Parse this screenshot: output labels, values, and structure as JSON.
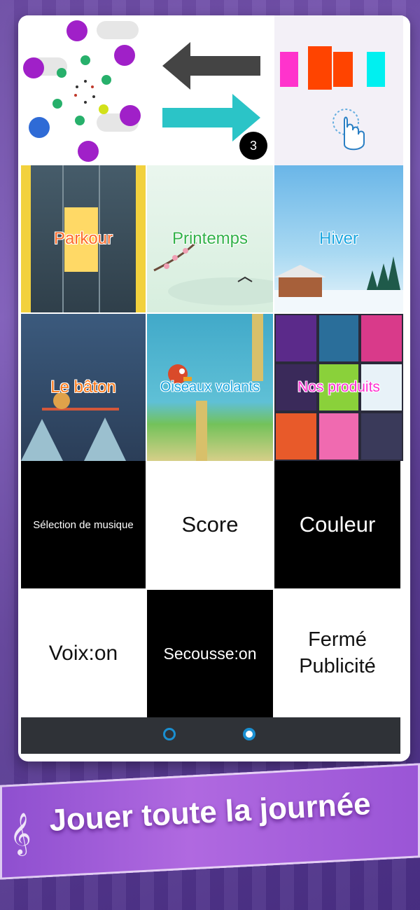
{
  "top": {
    "badge": "3",
    "colors": {
      "pink": "#ff33cc",
      "red": "#ff4400",
      "cyan": "#00f0f0",
      "dark_arrow": "#444444",
      "teal_arrow": "#2bc4c7"
    }
  },
  "games": [
    {
      "label": "Parkour",
      "color": "#ff6a2a"
    },
    {
      "label": "Printemps",
      "color": "#33b24a"
    },
    {
      "label": "Hiver",
      "color": "#1aa6e0"
    },
    {
      "label": "Le bâton",
      "color": "#ff7a1a"
    },
    {
      "label": "Oiseaux volants",
      "color": "#1aa6e0"
    },
    {
      "label": "Nos produits",
      "color": "#ff2fd0"
    }
  ],
  "menu": {
    "music_label": "Sélection de musique",
    "score_label": "Score",
    "color_label": "Couleur",
    "voice_label": "Voix:on",
    "shake_label": "Secousse:on",
    "ads_label_line1": "Fermé",
    "ads_label_line2": "Publicité"
  },
  "banner": {
    "text": "Jouer toute la journée"
  }
}
